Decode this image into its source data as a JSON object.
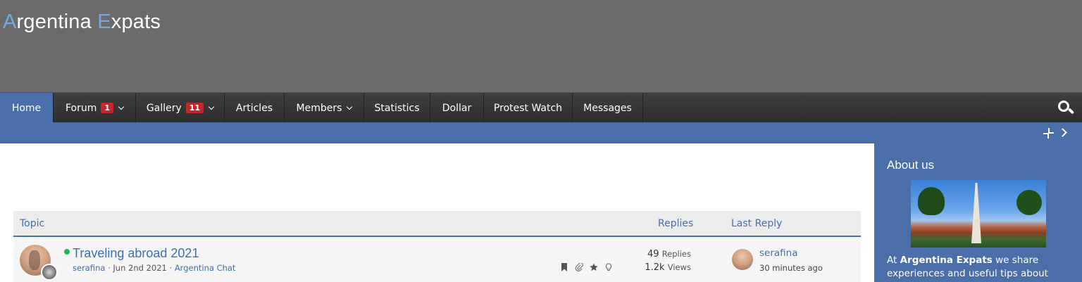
{
  "site": {
    "logo_first_letter": "A",
    "logo_part1": "rgentina ",
    "logo_second_letter": "E",
    "logo_part2": "xpats"
  },
  "nav": {
    "items": [
      {
        "label": "Home",
        "active": true
      },
      {
        "label": "Forum",
        "badge": "1",
        "dropdown": true
      },
      {
        "label": "Gallery",
        "badge": "11",
        "dropdown": true
      },
      {
        "label": "Articles"
      },
      {
        "label": "Members",
        "dropdown": true
      },
      {
        "label": "Statistics"
      },
      {
        "label": "Dollar"
      },
      {
        "label": "Protest Watch"
      },
      {
        "label": "Messages"
      }
    ],
    "search_icon": "search-icon"
  },
  "subbar": {
    "icons": [
      "collapse-icon",
      "chevron-right-icon"
    ]
  },
  "sidebar": {
    "title": "About us",
    "text_prefix": "At ",
    "text_bold": "Argentina Expats",
    "text_suffix": " we share experiences and useful tips about living"
  },
  "table": {
    "col_topic": "Topic",
    "col_replies": "Replies",
    "col_last_reply": "Last Reply",
    "rows": [
      {
        "title": "Traveling abroad 2021",
        "author": "serafina",
        "date": "Jun 2nd 2021",
        "forum": "Argentina Chat",
        "replies": "49",
        "replies_label": "Replies",
        "views": "1.2k",
        "views_label": "Views",
        "last_user": "serafina",
        "last_time": "30 minutes ago",
        "icons": [
          "bookmark-icon",
          "paperclip-icon",
          "star-icon",
          "lightbulb-icon"
        ]
      }
    ]
  },
  "colors": {
    "header_bg": "#6b6b6b",
    "nav_bg": "#333333",
    "accent": "#4a6fa8",
    "badge": "#c1272d",
    "link": "#3f6fb3",
    "online": "#1db954"
  }
}
